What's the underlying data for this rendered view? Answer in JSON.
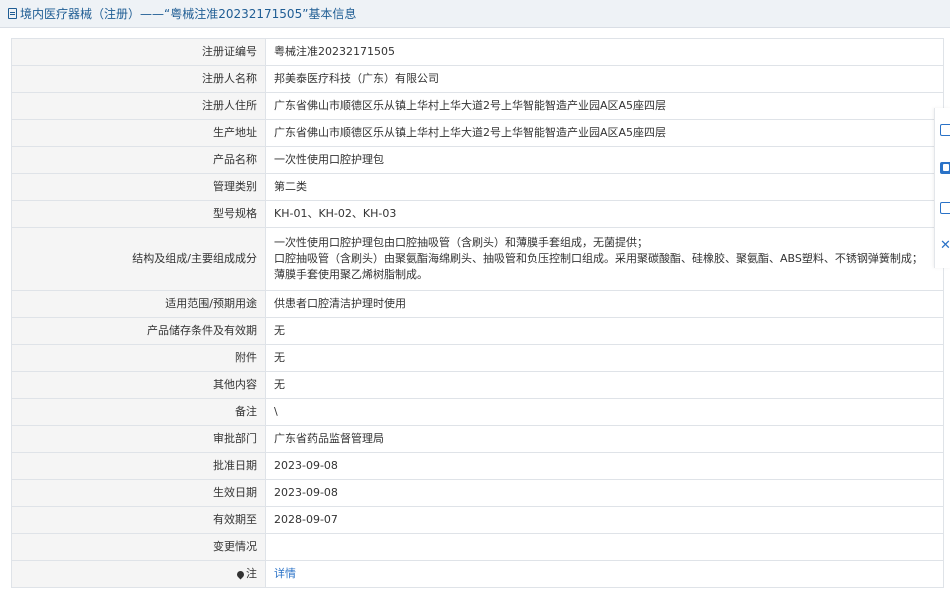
{
  "header": {
    "title": "境内医疗器械（注册）——“粤械注准20232171505”基本信息"
  },
  "rows": [
    {
      "label": "注册证编号",
      "value": "粤械注准20232171505"
    },
    {
      "label": "注册人名称",
      "value": "邦美泰医疗科技（广东）有限公司"
    },
    {
      "label": "注册人住所",
      "value": "广东省佛山市顺德区乐从镇上华村上华大道2号上华智能智造产业园A区A5座四层"
    },
    {
      "label": "生产地址",
      "value": "广东省佛山市顺德区乐从镇上华村上华大道2号上华智能智造产业园A区A5座四层"
    },
    {
      "label": "产品名称",
      "value": "一次性使用口腔护理包"
    },
    {
      "label": "管理类别",
      "value": "第二类"
    },
    {
      "label": "型号规格",
      "value": "KH-01、KH-02、KH-03"
    },
    {
      "label": "结构及组成/主要组成成分",
      "lines": [
        "一次性使用口腔护理包由口腔抽吸管（含刷头）和薄膜手套组成，无菌提供；",
        "口腔抽吸管（含刷头）由聚氨酯海绵刷头、抽吸管和负压控制口组成。采用聚碳酸酯、硅橡胶、聚氨酯、ABS塑料、不锈钢弹簧制成；",
        "薄膜手套使用聚乙烯树脂制成。"
      ]
    },
    {
      "label": "适用范围/预期用途",
      "value": "供患者口腔清洁护理时使用"
    },
    {
      "label": "产品储存条件及有效期",
      "value": "无"
    },
    {
      "label": "附件",
      "value": "无"
    },
    {
      "label": "其他内容",
      "value": "无"
    },
    {
      "label": "备注",
      "value": "\\"
    },
    {
      "label": "审批部门",
      "value": "广东省药品监督管理局"
    },
    {
      "label": "批准日期",
      "value": "2023-09-08"
    },
    {
      "label": "生效日期",
      "value": "2023-09-08"
    },
    {
      "label": "有效期至",
      "value": "2028-09-07"
    },
    {
      "label": "变更情况",
      "value": ""
    },
    {
      "label": "注",
      "value": "详情"
    }
  ]
}
